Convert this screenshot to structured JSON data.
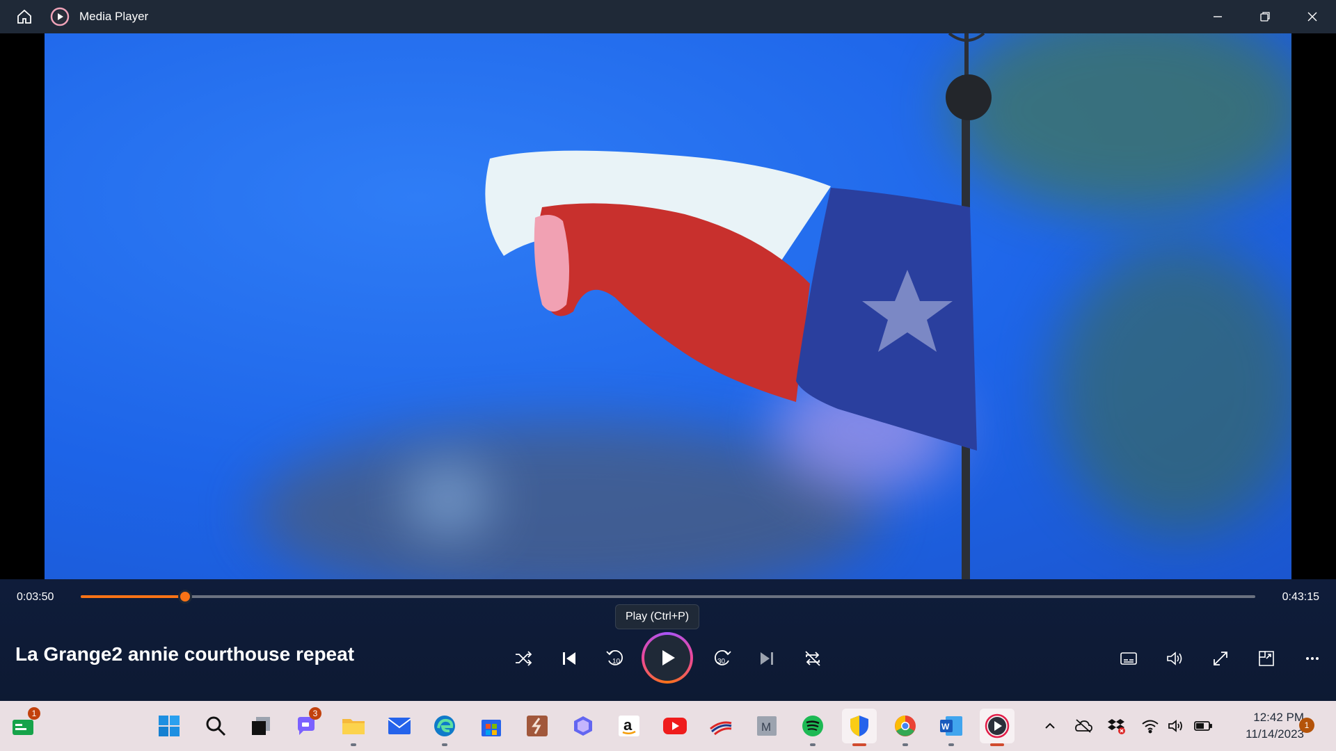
{
  "window": {
    "title": "Media Player"
  },
  "player": {
    "elapsed": "0:03:50",
    "duration": "0:43:15",
    "progress_fraction": 0.089,
    "tooltip": "Play (Ctrl+P)",
    "track_title": "La Grange2 annie courthouse repeat"
  },
  "taskbar": {
    "badges": {
      "news": "1",
      "teams": "3"
    },
    "clock_time": "12:42 PM",
    "clock_date": "11/14/2023",
    "notification_count": "1"
  },
  "colors": {
    "accent": "#f97316",
    "controls_bg": "#0f1c3a",
    "titlebar_bg": "#1f2937",
    "taskbar_bg": "#eadfe3"
  }
}
